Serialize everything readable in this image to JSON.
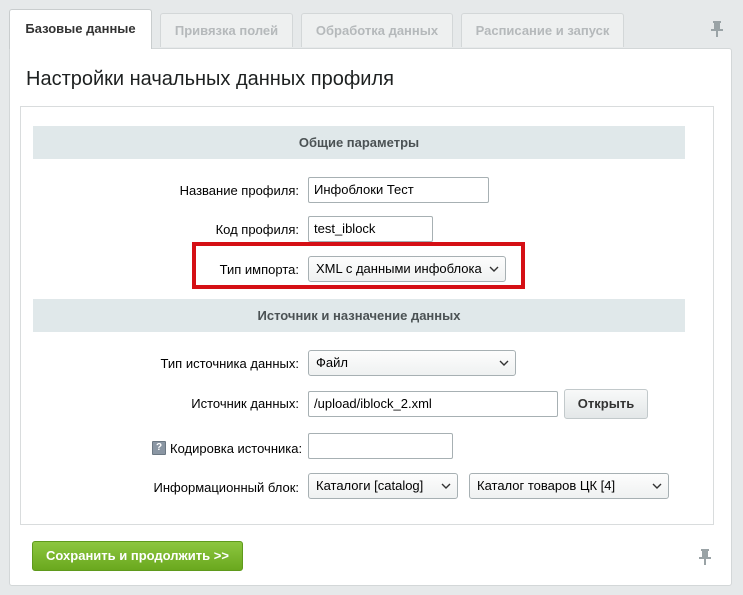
{
  "tabs": [
    {
      "label": "Базовые данные",
      "active": true
    },
    {
      "label": "Привязка полей",
      "active": false
    },
    {
      "label": "Обработка данных",
      "active": false
    },
    {
      "label": "Расписание и запуск",
      "active": false
    }
  ],
  "page_title": "Настройки начальных данных профиля",
  "section_general": "Общие параметры",
  "section_source": "Источник и назначение данных",
  "fields": {
    "profile_name": {
      "label": "Название профиля:",
      "value": "Инфоблоки Тест"
    },
    "profile_code": {
      "label": "Код профиля:",
      "value": "test_iblock"
    },
    "import_type": {
      "label": "Тип импорта:",
      "value": "XML с данными инфоблока"
    },
    "source_type": {
      "label": "Тип источника данных:",
      "value": "Файл"
    },
    "source": {
      "label": "Источник данных:",
      "value": "/upload/iblock_2.xml",
      "button": "Открыть"
    },
    "encoding": {
      "label": "Кодировка источника:",
      "value": "",
      "help_icon": "?"
    },
    "iblock": {
      "label": "Информационный блок:",
      "type_value": "Каталоги [catalog]",
      "block_value": "Каталог товаров ЦК [4]"
    }
  },
  "save_button": "Сохранить и продолжить >>",
  "colors": {
    "highlight_border": "#d50f15",
    "save_button": "#7bb52d",
    "section_header_bg": "#e0e8ea"
  },
  "icons": {
    "pin": "pin-icon",
    "chevron": "chevron-down-icon",
    "help": "help-icon"
  }
}
